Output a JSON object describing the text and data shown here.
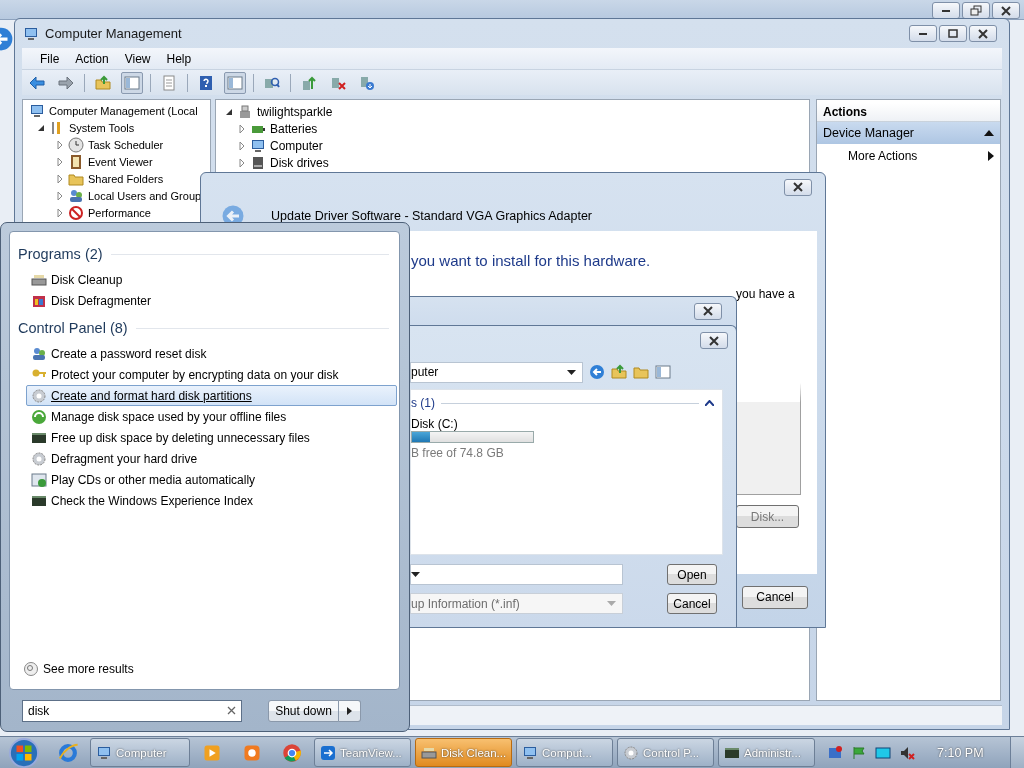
{
  "computer_management": {
    "title": "Computer Management",
    "menu": [
      "File",
      "Action",
      "View",
      "Help"
    ],
    "tree": [
      {
        "label": "Computer Management (Local",
        "children": [
          {
            "label": "System Tools",
            "expanded": true,
            "children": [
              {
                "label": "Task Scheduler",
                "expanded": false
              },
              {
                "label": "Event Viewer",
                "expanded": false
              },
              {
                "label": "Shared Folders",
                "expanded": false
              },
              {
                "label": "Local Users and Group",
                "expanded": false
              },
              {
                "label": "Performance",
                "expanded": false
              }
            ]
          }
        ]
      }
    ],
    "devices": [
      {
        "label": "twilightsparkle",
        "expanded": true,
        "children": [
          {
            "label": "Batteries",
            "expanded": false
          },
          {
            "label": "Computer",
            "expanded": false
          },
          {
            "label": "Disk drives",
            "expanded": false
          }
        ]
      }
    ],
    "actions": {
      "title": "Actions",
      "section": {
        "label": "Device Manager",
        "expanded": true
      },
      "items": [
        "More Actions"
      ]
    }
  },
  "update_driver": {
    "title": "Update Driver Software - Standard VGA Graphics Adapter",
    "heading": "you want to install for this hardware.",
    "text": "you have a",
    "disk_button": "Disk...",
    "cancel_button": "Cancel"
  },
  "open_dialog": {
    "location": "puter",
    "group": "s (1)",
    "group_expanded": true,
    "drive": {
      "name": "Disk (C:)",
      "level": 0.15,
      "free": "B free of 74.8 GB"
    },
    "file_type": "up Information (*.inf)",
    "buttons": [
      "Open",
      "Cancel"
    ]
  },
  "start_menu": {
    "groups": [
      {
        "title": "Programs (2)",
        "items": [
          {
            "label": "Disk Cleanup",
            "selected": false
          },
          {
            "label": "Disk Defragmenter",
            "selected": false
          }
        ]
      },
      {
        "title": "Control Panel (8)",
        "items": [
          {
            "label": "Create a password reset disk",
            "selected": false
          },
          {
            "label": "Protect your computer by encrypting data on your disk",
            "selected": false
          },
          {
            "label": "Create and format hard disk partitions",
            "selected": true
          },
          {
            "label": "Manage disk space used by your offline files",
            "selected": false
          },
          {
            "label": "Free up disk space by deleting unnecessary files",
            "selected": false
          },
          {
            "label": "Defragment your hard drive",
            "selected": false
          },
          {
            "label": "Play CDs or other media automatically",
            "selected": false
          },
          {
            "label": "Check the Windows Experience Index",
            "selected": false
          }
        ]
      }
    ],
    "see_more": "See more results",
    "search": {
      "value": "disk"
    },
    "shutdown_button": "Shut down"
  },
  "taskbar": {
    "windows": [
      {
        "label": "Computer",
        "selected": false
      },
      {
        "label": "TeamView...",
        "selected": false
      },
      {
        "label": "Disk Clean...",
        "selected": true
      },
      {
        "label": "Comput...",
        "selected": false
      },
      {
        "label": "Control P...",
        "selected": false
      },
      {
        "label": "Administr...",
        "selected": false
      }
    ],
    "clock": "7:10 PM"
  }
}
